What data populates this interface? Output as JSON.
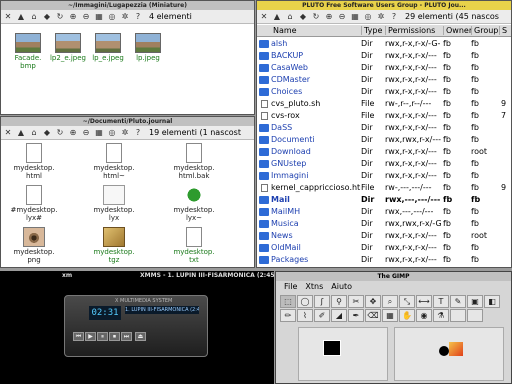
{
  "windows": {
    "top_left": {
      "title": "~/Immagini/Lugapezzia (Miniature)",
      "status": "4 elementi",
      "items": [
        {
          "label": "Facade.\nbmp",
          "kind": "photo"
        },
        {
          "label": "lp2_e.jpeg",
          "kind": "photo2"
        },
        {
          "label": "lp_e.jpeg",
          "kind": "photo2"
        },
        {
          "label": "lp.jpeg",
          "kind": "photo"
        }
      ]
    },
    "mid_left": {
      "title": "~/Documenti/Pluto.journal",
      "status": "19 elementi (1 nascost",
      "items": [
        {
          "label": "mydesktop.\nhtml",
          "kind": "doc",
          "color": "dark"
        },
        {
          "label": "mydesktop.\nhtml~",
          "kind": "doc",
          "color": "dark"
        },
        {
          "label": "mydesktop.\nhtml.bak",
          "kind": "doc",
          "color": "dark"
        },
        {
          "label": "#mydesktop.\nlyx#",
          "kind": "doc",
          "color": "dark"
        },
        {
          "label": "mydesktop.\nlyx",
          "kind": "lyx",
          "color": "dark"
        },
        {
          "label": "mydesktop.\nlyx~",
          "kind": "recycle",
          "color": "dark"
        },
        {
          "label": "mydesktop.\npng",
          "kind": "eye",
          "color": "dark"
        },
        {
          "label": "mydesktop.\ntgz",
          "kind": "tgz",
          "color": "green"
        },
        {
          "label": "mydesktop.\ntxt",
          "kind": "doc",
          "color": "green"
        }
      ]
    },
    "right": {
      "title": "PLUTO Free Software Users Group - PLUTO Jou...",
      "status": "29 elementi (45 nascos",
      "columns": [
        "Name",
        "Type",
        "Permissions",
        "Owner",
        "Group",
        "S"
      ],
      "rows": [
        {
          "name": "alsh",
          "type": "Dir",
          "perm": "rwx,r-x,r-x/-G-",
          "owner": "fb",
          "group": "fb",
          "size": "",
          "dir": true
        },
        {
          "name": "BACKUP",
          "type": "Dir",
          "perm": "rwx,r-x,r-x/---",
          "owner": "fb",
          "group": "fb",
          "size": "",
          "dir": true
        },
        {
          "name": "CasaWeb",
          "type": "Dir",
          "perm": "rwx,r-x,r-x/---",
          "owner": "fb",
          "group": "fb",
          "size": "",
          "dir": true
        },
        {
          "name": "CDMaster",
          "type": "Dir",
          "perm": "rwx,r-x,r-x/---",
          "owner": "fb",
          "group": "fb",
          "size": "",
          "dir": true
        },
        {
          "name": "Choices",
          "type": "Dir",
          "perm": "rwx,r-x,r-x/---",
          "owner": "fb",
          "group": "fb",
          "size": "",
          "dir": true
        },
        {
          "name": "cvs_pluto.sh",
          "type": "File",
          "perm": "rw-,r--,r--/---",
          "owner": "fb",
          "group": "fb",
          "size": "9",
          "dir": false
        },
        {
          "name": "cvs-rox",
          "type": "File",
          "perm": "rwx,r-x,r-x/---",
          "owner": "fb",
          "group": "fb",
          "size": "7",
          "dir": false
        },
        {
          "name": "DaSS",
          "type": "Dir",
          "perm": "rwx,r-x,r-x/---",
          "owner": "fb",
          "group": "fb",
          "size": "",
          "dir": true
        },
        {
          "name": "Documenti",
          "type": "Dir",
          "perm": "rwx,rwx,r-x/---",
          "owner": "fb",
          "group": "fb",
          "size": "",
          "dir": true
        },
        {
          "name": "Download",
          "type": "Dir",
          "perm": "rwx,r-x,r-x/---",
          "owner": "fb",
          "group": "root",
          "size": "",
          "dir": true
        },
        {
          "name": "GNUstep",
          "type": "Dir",
          "perm": "rwx,r-x,r-x/---",
          "owner": "fb",
          "group": "fb",
          "size": "",
          "dir": true
        },
        {
          "name": "Immagini",
          "type": "Dir",
          "perm": "rwx,r-x,r-x/---",
          "owner": "fb",
          "group": "fb",
          "size": "",
          "dir": true
        },
        {
          "name": "kernel_cappriccioso.html",
          "type": "File",
          "perm": "rw-,---,---/---",
          "owner": "fb",
          "group": "fb",
          "size": "9",
          "dir": false
        },
        {
          "name": "Mail",
          "type": "Dir",
          "perm": "rwx,---,---/---",
          "owner": "fb",
          "group": "fb",
          "size": "",
          "dir": true,
          "bold": true
        },
        {
          "name": "MailMH",
          "type": "Dir",
          "perm": "rwx,---,---/---",
          "owner": "fb",
          "group": "fb",
          "size": "",
          "dir": true
        },
        {
          "name": "Musica",
          "type": "Dir",
          "perm": "rwx,rwx,r-x/-G-",
          "owner": "fb",
          "group": "fb",
          "size": "",
          "dir": true
        },
        {
          "name": "News",
          "type": "Dir",
          "perm": "rwx,r-x,r-x/---",
          "owner": "fb",
          "group": "root",
          "size": "",
          "dir": true
        },
        {
          "name": "OldMail",
          "type": "Dir",
          "perm": "rwx,r-x,r-x/---",
          "owner": "fb",
          "group": "fb",
          "size": "",
          "dir": true
        },
        {
          "name": "Packages",
          "type": "Dir",
          "perm": "rwx,r-x,r-x/---",
          "owner": "fb",
          "group": "fb",
          "size": "",
          "dir": true
        }
      ]
    },
    "xmms": {
      "title": "XMMS - 1. LUPIN III-FISARMONICA (2:45)",
      "left_tag": "xm",
      "brand": "X MULTIMEDIA SYSTEM",
      "time": "02:31",
      "song": "1. LUPIN III-FISARMONICA (2:45)",
      "buttons": [
        "⏮",
        "▶",
        "⏸",
        "⏹",
        "⏭",
        "⏏"
      ]
    },
    "gimp": {
      "title": "The GIMP",
      "menu": [
        "File",
        "Xtns",
        "Aiuto"
      ],
      "tools": [
        "⬚",
        "◯",
        "ʃ",
        "⚲",
        "✂",
        "✥",
        "⌕",
        "⤡",
        "⟷",
        "T",
        "✎",
        "▣",
        "◧",
        "✏",
        "⌇",
        "✐",
        "◢",
        "✒",
        "⌫",
        "▦",
        "✋",
        "◉",
        "⚗",
        "",
        ""
      ]
    }
  }
}
